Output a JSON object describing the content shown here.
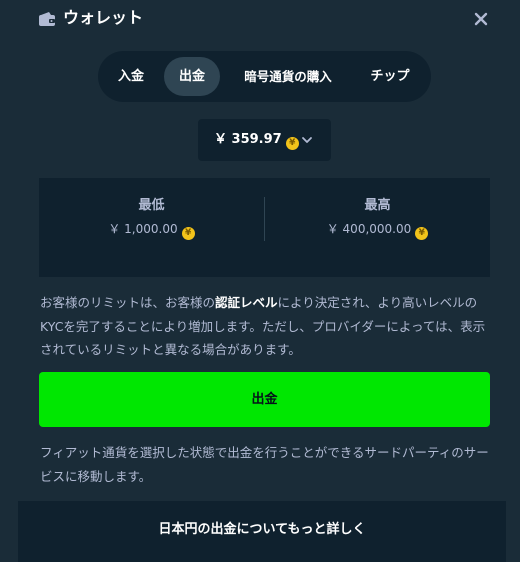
{
  "header": {
    "title": "ウォレット",
    "wallet_icon": "wallet-icon",
    "close_icon": "close-icon"
  },
  "tabs": [
    {
      "label": "入金",
      "active": false
    },
    {
      "label": "出金",
      "active": true
    },
    {
      "label": "暗号通貨の購入",
      "active": false
    },
    {
      "label": "チップ",
      "active": false
    }
  ],
  "currency": {
    "amount": "￥ 359.97",
    "coin_symbol": "¥",
    "chevron_icon": "chevron-down-icon"
  },
  "limits": {
    "min_label": "最低",
    "min_value": "￥ 1,000.00",
    "max_label": "最高",
    "max_value": "￥ 400,000.00"
  },
  "info": {
    "part1": "お客様のリミットは、お客様の",
    "bold": "認証レベル",
    "part2": "により決定され、より高いレベルのKYCを完了することにより増加します。ただし、プロバイダーによっては、表示されているリミットと異なる場合があります。"
  },
  "withdraw_button": {
    "label": "出金"
  },
  "note": {
    "text": "フィアット通貨を選択した状態で出金を行うことができるサードパーティのサービスに移動します。"
  },
  "footer": {
    "link_label": "日本円の出金についてもっと詳しく"
  },
  "colors": {
    "background": "#1a2c38",
    "panel": "#0f212e",
    "active_tab": "#2f4553",
    "accent_green": "#00e701",
    "muted_text": "#b1bad3",
    "coin": "#f2c31a"
  }
}
